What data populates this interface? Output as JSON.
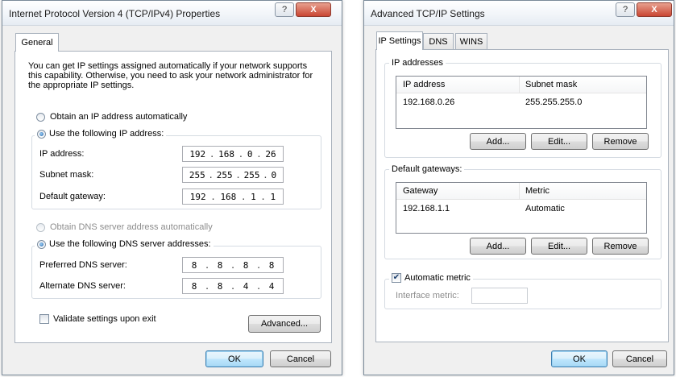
{
  "left_dialog": {
    "title": "Internet Protocol Version 4 (TCP/IPv4) Properties",
    "help_label": "?",
    "close_label": "X",
    "tab_general": "General",
    "description": "You can get IP settings assigned automatically if your network supports this capability. Otherwise, you need to ask your network administrator for the appropriate IP settings.",
    "radio_obtain_ip": "Obtain an IP address automatically",
    "radio_use_ip": "Use the following IP address:",
    "ip_label": "IP address:",
    "ip_value": [
      "192",
      "168",
      "0",
      "26"
    ],
    "subnet_label": "Subnet mask:",
    "subnet_value": [
      "255",
      "255",
      "255",
      "0"
    ],
    "gateway_label": "Default gateway:",
    "gateway_value": [
      "192",
      "168",
      "1",
      "1"
    ],
    "radio_obtain_dns": "Obtain DNS server address automatically",
    "radio_use_dns": "Use the following DNS server addresses:",
    "pref_dns_label": "Preferred DNS server:",
    "pref_dns_value": [
      "8",
      "8",
      "8",
      "8"
    ],
    "alt_dns_label": "Alternate DNS server:",
    "alt_dns_value": [
      "8",
      "8",
      "4",
      "4"
    ],
    "validate_label": "Validate settings upon exit",
    "advanced_label": "Advanced...",
    "ok_label": "OK",
    "cancel_label": "Cancel"
  },
  "right_dialog": {
    "title": "Advanced TCP/IP Settings",
    "help_label": "?",
    "close_label": "X",
    "tabs": [
      "IP Settings",
      "DNS",
      "WINS"
    ],
    "ip_group_label": "IP addresses",
    "ip_columns": [
      "IP address",
      "Subnet mask"
    ],
    "ip_rows": [
      [
        "192.168.0.26",
        "255.255.255.0"
      ]
    ],
    "gw_group_label": "Default gateways:",
    "gw_columns": [
      "Gateway",
      "Metric"
    ],
    "gw_rows": [
      [
        "192.168.1.1",
        "Automatic"
      ]
    ],
    "add_label": "Add...",
    "edit_label": "Edit...",
    "remove_label": "Remove",
    "auto_metric_label": "Automatic metric",
    "auto_metric_checked": true,
    "interface_metric_label": "Interface metric:",
    "ok_label": "OK",
    "cancel_label": "Cancel"
  }
}
